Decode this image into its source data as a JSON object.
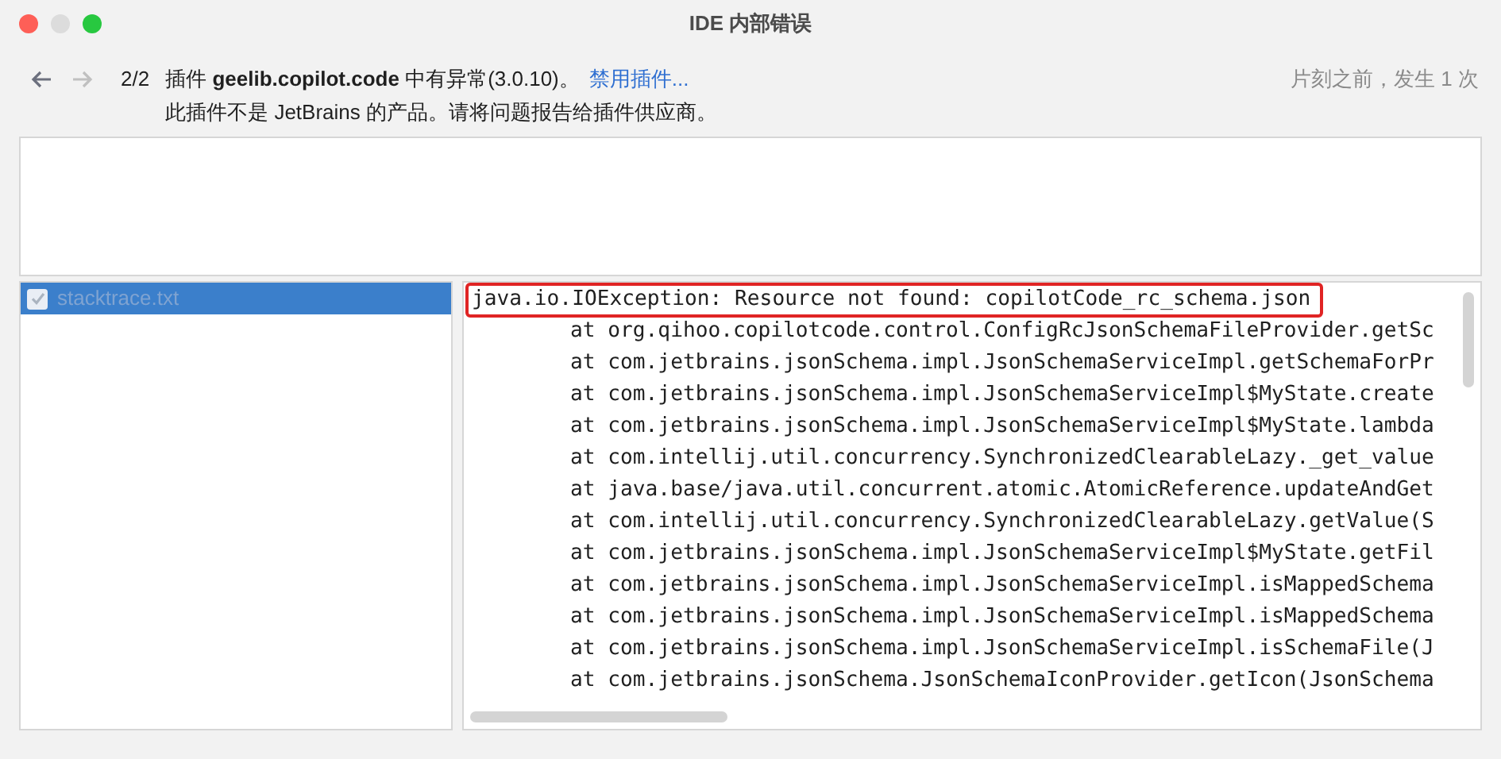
{
  "window": {
    "title": "IDE 内部错误"
  },
  "nav": {
    "back": {
      "disabled": false
    },
    "forward": {
      "disabled": true
    },
    "counter": "2/2"
  },
  "message": {
    "prefix": "插件",
    "plugin": "geelib.copilot.code",
    "suffix": "中有异常(3.0.10)。",
    "link": "禁用插件...",
    "note": "此插件不是 JetBrains 的产品。请将问题报告给插件供应商。",
    "time": "片刻之前，发生 1 次"
  },
  "attachments": [
    {
      "name": "stacktrace.txt",
      "checked": true,
      "selected": true
    }
  ],
  "stacktrace": {
    "lines": [
      {
        "text": "java.io.IOException: Resource not found: copilotCode_rc_schema.json",
        "kind": "exception",
        "highlighted": true
      },
      {
        "text": "at org.qihoo.copilotcode.control.ConfigRcJsonSchemaFileProvider.getSc",
        "kind": "frame",
        "highlighted": false
      },
      {
        "text": "at com.jetbrains.jsonSchema.impl.JsonSchemaServiceImpl.getSchemaForPr",
        "kind": "frame",
        "highlighted": false
      },
      {
        "text": "at com.jetbrains.jsonSchema.impl.JsonSchemaServiceImpl$MyState.create",
        "kind": "frame",
        "highlighted": false
      },
      {
        "text": "at com.jetbrains.jsonSchema.impl.JsonSchemaServiceImpl$MyState.lambda",
        "kind": "frame",
        "highlighted": false
      },
      {
        "text": "at com.intellij.util.concurrency.SynchronizedClearableLazy._get_value",
        "kind": "frame",
        "highlighted": false
      },
      {
        "text": "at java.base/java.util.concurrent.atomic.AtomicReference.updateAndGet",
        "kind": "frame",
        "highlighted": false
      },
      {
        "text": "at com.intellij.util.concurrency.SynchronizedClearableLazy.getValue(S",
        "kind": "frame",
        "highlighted": false
      },
      {
        "text": "at com.jetbrains.jsonSchema.impl.JsonSchemaServiceImpl$MyState.getFil",
        "kind": "frame",
        "highlighted": false
      },
      {
        "text": "at com.jetbrains.jsonSchema.impl.JsonSchemaServiceImpl.isMappedSchema",
        "kind": "frame",
        "highlighted": false
      },
      {
        "text": "at com.jetbrains.jsonSchema.impl.JsonSchemaServiceImpl.isMappedSchema",
        "kind": "frame",
        "highlighted": false
      },
      {
        "text": "at com.jetbrains.jsonSchema.impl.JsonSchemaServiceImpl.isSchemaFile(J",
        "kind": "frame",
        "highlighted": false
      },
      {
        "text": "at com.jetbrains.jsonSchema.JsonSchemaIconProvider.getIcon(JsonSchema",
        "kind": "frame",
        "highlighted": false
      }
    ]
  }
}
